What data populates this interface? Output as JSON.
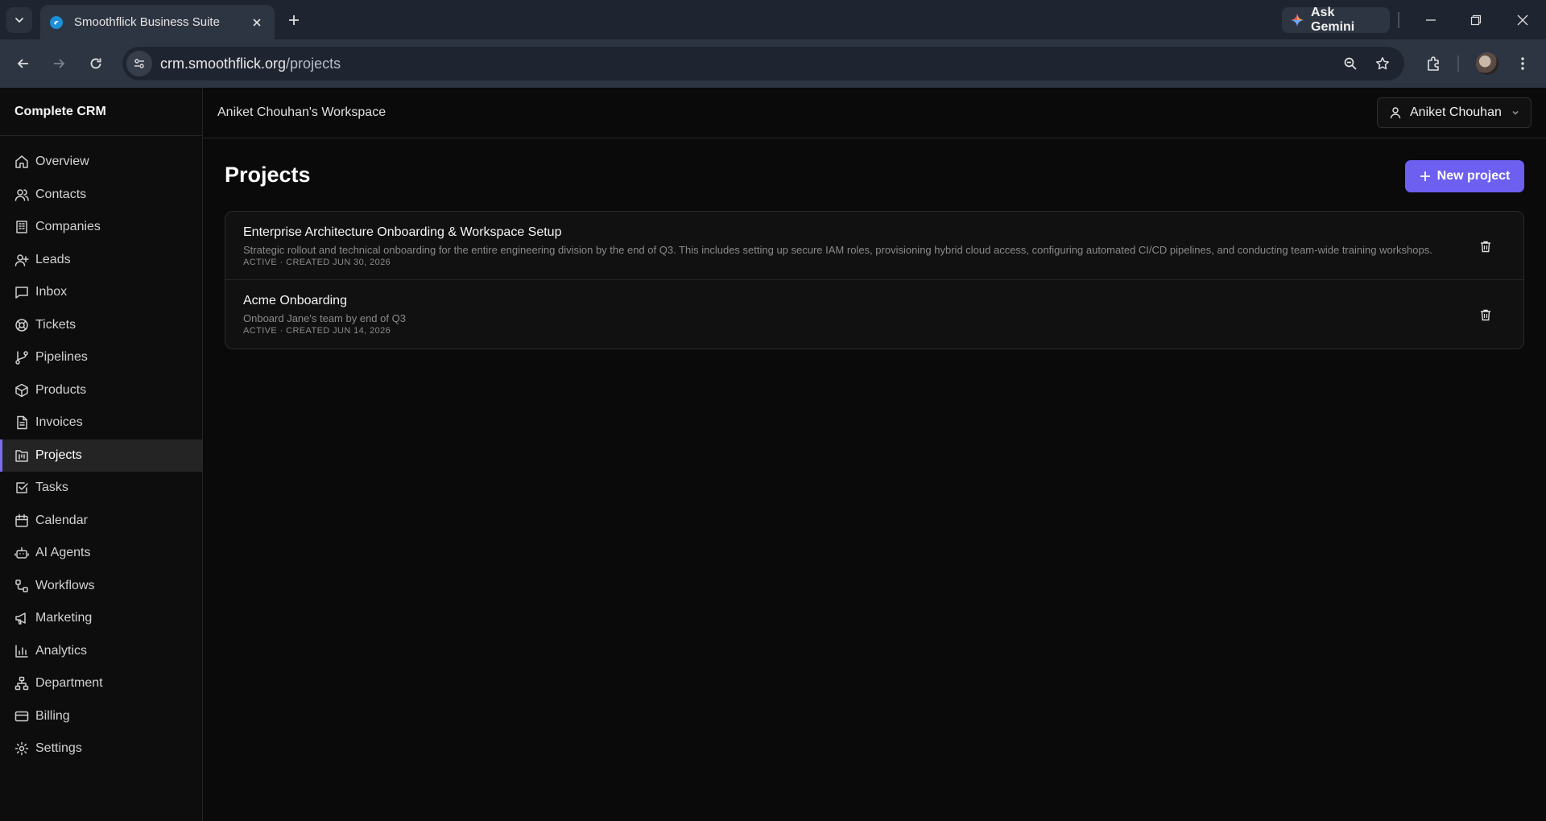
{
  "browser": {
    "tab_title": "Smoothflick Business Suite",
    "url_host": "crm.smoothflick.org",
    "url_path": "/projects",
    "gemini_label": "Ask Gemini"
  },
  "app": {
    "brand": "Complete CRM",
    "workspace": "Aniket Chouhan's Workspace",
    "user_name": "Aniket Chouhan",
    "accent_color": "#6d5ff0"
  },
  "sidebar": {
    "items": [
      {
        "label": "Overview",
        "icon": "home-icon"
      },
      {
        "label": "Contacts",
        "icon": "users-icon"
      },
      {
        "label": "Companies",
        "icon": "building-icon"
      },
      {
        "label": "Leads",
        "icon": "user-plus-icon"
      },
      {
        "label": "Inbox",
        "icon": "message-icon"
      },
      {
        "label": "Tickets",
        "icon": "lifebuoy-icon"
      },
      {
        "label": "Pipelines",
        "icon": "git-branch-icon"
      },
      {
        "label": "Products",
        "icon": "package-icon"
      },
      {
        "label": "Invoices",
        "icon": "file-text-icon"
      },
      {
        "label": "Projects",
        "icon": "folder-kanban-icon",
        "active": true
      },
      {
        "label": "Tasks",
        "icon": "check-square-icon"
      },
      {
        "label": "Calendar",
        "icon": "calendar-icon"
      },
      {
        "label": "AI Agents",
        "icon": "bot-icon"
      },
      {
        "label": "Workflows",
        "icon": "workflow-icon"
      },
      {
        "label": "Marketing",
        "icon": "megaphone-icon"
      },
      {
        "label": "Analytics",
        "icon": "bar-chart-icon"
      },
      {
        "label": "Department",
        "icon": "network-icon"
      },
      {
        "label": "Billing",
        "icon": "credit-card-icon"
      },
      {
        "label": "Settings",
        "icon": "gear-icon"
      }
    ]
  },
  "main": {
    "title": "Projects",
    "new_button": "New project",
    "projects": [
      {
        "name": "Enterprise Architecture Onboarding & Workspace Setup",
        "description": "Strategic rollout and technical onboarding for the entire engineering division by the end of Q3. This includes setting up secure IAM roles, provisioning hybrid cloud access, configuring automated CI/CD pipelines, and conducting team-wide training workshops.",
        "meta": "ACTIVE · CREATED JUN 30, 2026"
      },
      {
        "name": "Acme Onboarding",
        "description": "Onboard Jane's team by end of Q3",
        "meta": "ACTIVE · CREATED JUN 14, 2026"
      }
    ]
  }
}
